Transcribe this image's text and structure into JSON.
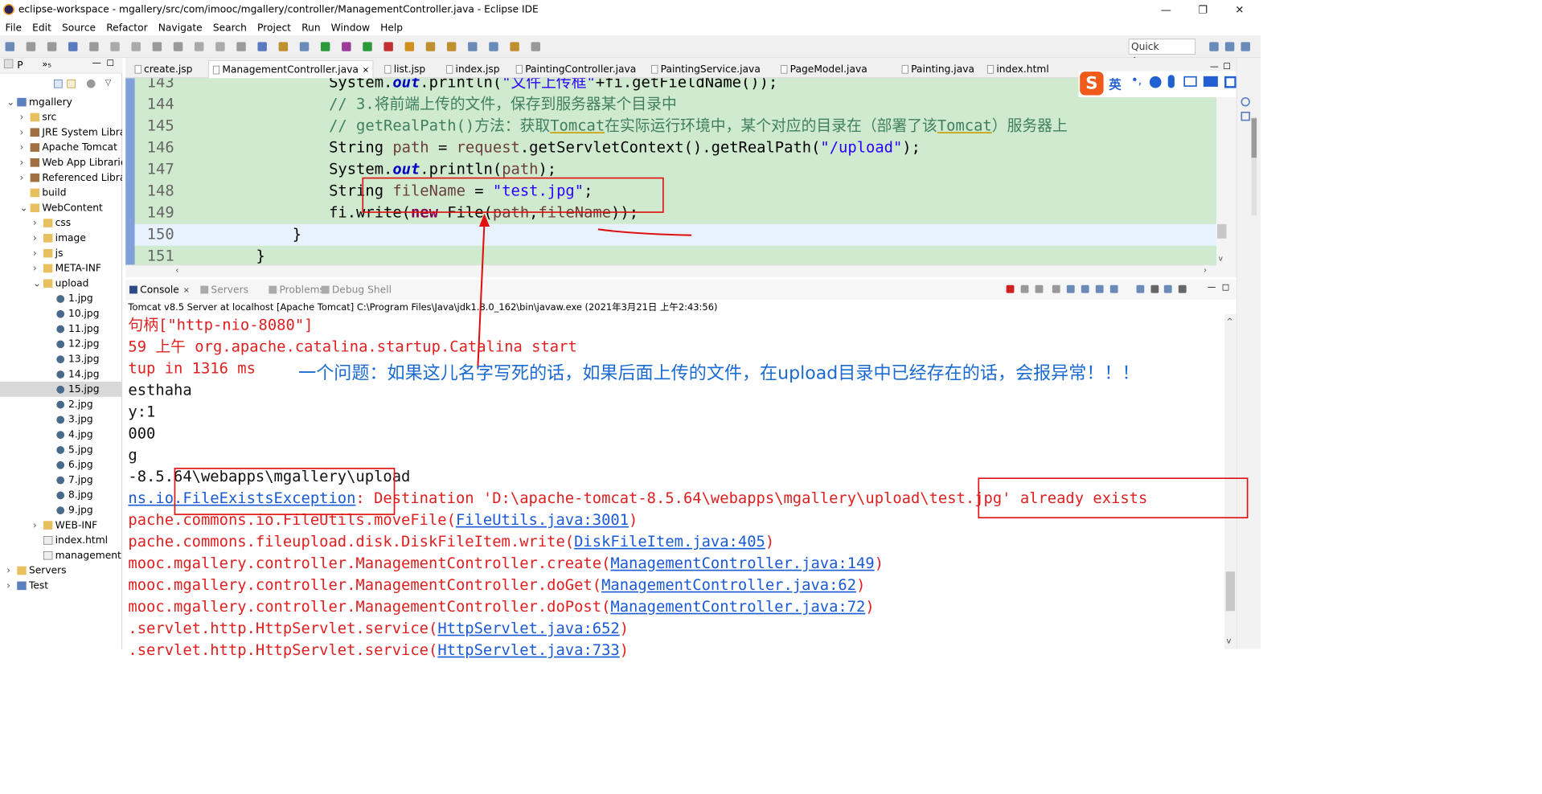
{
  "window": {
    "title": "eclipse-workspace - mgallery/src/com/imooc/mgallery/controller/ManagementController.java - Eclipse IDE",
    "minimize_label": "—",
    "restore_label": "❐",
    "close_label": "✕"
  },
  "menu": [
    "File",
    "Edit",
    "Source",
    "Refactor",
    "Navigate",
    "Search",
    "Project",
    "Run",
    "Window",
    "Help"
  ],
  "quick_access": {
    "placeholder": "Quick Access"
  },
  "explorer": {
    "tab_label": "P",
    "tab_label2": "»₅",
    "items": [
      {
        "label": "mgallery",
        "depth": 0,
        "twisty": "v",
        "icon": "project-icon"
      },
      {
        "label": "src",
        "depth": 1,
        "twisty": ">",
        "icon": "folder-icon"
      },
      {
        "label": "JRE System Library",
        "depth": 1,
        "twisty": ">",
        "icon": "library-icon"
      },
      {
        "label": "Apache Tomcat",
        "depth": 1,
        "twisty": ">",
        "icon": "library-icon"
      },
      {
        "label": "Web App Libraries",
        "depth": 1,
        "twisty": ">",
        "icon": "library-icon"
      },
      {
        "label": "Referenced Libraries",
        "depth": 1,
        "twisty": ">",
        "icon": "library-icon"
      },
      {
        "label": "build",
        "depth": 1,
        "twisty": "",
        "icon": "folder-icon"
      },
      {
        "label": "WebContent",
        "depth": 1,
        "twisty": "v",
        "icon": "folder-icon"
      },
      {
        "label": "css",
        "depth": 2,
        "twisty": ">",
        "icon": "folder-icon"
      },
      {
        "label": "image",
        "depth": 2,
        "twisty": ">",
        "icon": "folder-icon"
      },
      {
        "label": "js",
        "depth": 2,
        "twisty": ">",
        "icon": "folder-icon"
      },
      {
        "label": "META-INF",
        "depth": 2,
        "twisty": ">",
        "icon": "folder-icon"
      },
      {
        "label": "upload",
        "depth": 2,
        "twisty": "v",
        "icon": "folder-icon"
      },
      {
        "label": "1.jpg",
        "depth": 3,
        "twisty": "",
        "icon": "image-file-icon"
      },
      {
        "label": "10.jpg",
        "depth": 3,
        "twisty": "",
        "icon": "image-file-icon"
      },
      {
        "label": "11.jpg",
        "depth": 3,
        "twisty": "",
        "icon": "image-file-icon"
      },
      {
        "label": "12.jpg",
        "depth": 3,
        "twisty": "",
        "icon": "image-file-icon"
      },
      {
        "label": "13.jpg",
        "depth": 3,
        "twisty": "",
        "icon": "image-file-icon"
      },
      {
        "label": "14.jpg",
        "depth": 3,
        "twisty": "",
        "icon": "image-file-icon"
      },
      {
        "label": "15.jpg",
        "depth": 3,
        "twisty": "",
        "icon": "image-file-icon",
        "selected": true
      },
      {
        "label": "2.jpg",
        "depth": 3,
        "twisty": "",
        "icon": "image-file-icon"
      },
      {
        "label": "3.jpg",
        "depth": 3,
        "twisty": "",
        "icon": "image-file-icon"
      },
      {
        "label": "4.jpg",
        "depth": 3,
        "twisty": "",
        "icon": "image-file-icon"
      },
      {
        "label": "5.jpg",
        "depth": 3,
        "twisty": "",
        "icon": "image-file-icon"
      },
      {
        "label": "6.jpg",
        "depth": 3,
        "twisty": "",
        "icon": "image-file-icon"
      },
      {
        "label": "7.jpg",
        "depth": 3,
        "twisty": "",
        "icon": "image-file-icon"
      },
      {
        "label": "8.jpg",
        "depth": 3,
        "twisty": "",
        "icon": "image-file-icon"
      },
      {
        "label": "9.jpg",
        "depth": 3,
        "twisty": "",
        "icon": "image-file-icon"
      },
      {
        "label": "WEB-INF",
        "depth": 2,
        "twisty": ">",
        "icon": "folder-icon"
      },
      {
        "label": "index.html",
        "depth": 2,
        "twisty": "",
        "icon": "file-icon"
      },
      {
        "label": "management.",
        "depth": 2,
        "twisty": "",
        "icon": "file-icon"
      },
      {
        "label": "Servers",
        "depth": 0,
        "twisty": ">",
        "icon": "folder-icon"
      },
      {
        "label": "Test",
        "depth": 0,
        "twisty": ">",
        "icon": "project-icon"
      }
    ]
  },
  "editor": {
    "tabs": [
      {
        "label": "create.jsp",
        "active": false
      },
      {
        "label": "ManagementController.java",
        "active": true,
        "close": "✕"
      },
      {
        "label": "list.jsp",
        "active": false
      },
      {
        "label": "index.jsp",
        "active": false
      },
      {
        "label": "PaintingController.java",
        "active": false
      },
      {
        "label": "PaintingService.java",
        "active": false
      },
      {
        "label": "PageModel.java",
        "active": false
      },
      {
        "label": "Painting.java",
        "active": false
      },
      {
        "label": "index.html",
        "active": false
      }
    ],
    "lines": [
      {
        "num": "143",
        "indent": "                 ",
        "parts": [
          [
            "System.",
            ""
          ],
          [
            "out",
            "fld"
          ],
          [
            ".println(",
            ""
          ],
          [
            "\"文件上传框\"",
            "str"
          ],
          [
            "+fi.getFieldName());",
            ""
          ]
        ]
      },
      {
        "num": "144",
        "indent": "                 ",
        "parts": [
          [
            "// 3.将前端上传的文件，保存到服务器某个目录中",
            "cmt"
          ]
        ]
      },
      {
        "num": "145",
        "indent": "                 ",
        "parts": [
          [
            "// getRealPath()方法：获取",
            "cmt"
          ],
          [
            "Tomcat",
            "cmt und"
          ],
          [
            "在实际运行环境中，某个对应的目录在（部署了该",
            "cmt"
          ],
          [
            "Tomcat",
            "cmt und"
          ],
          [
            "）服务器上",
            "cmt"
          ]
        ]
      },
      {
        "num": "146",
        "indent": "                 ",
        "parts": [
          [
            "String ",
            ""
          ],
          [
            "path",
            "var"
          ],
          [
            " = ",
            ""
          ],
          [
            "request",
            "var"
          ],
          [
            ".getServletContext().getRealPath(",
            ""
          ],
          [
            "\"/upload\"",
            "str"
          ],
          [
            ");",
            ""
          ]
        ]
      },
      {
        "num": "147",
        "indent": "                 ",
        "parts": [
          [
            "System.",
            ""
          ],
          [
            "out",
            "fld"
          ],
          [
            ".println(",
            ""
          ],
          [
            "path",
            "var"
          ],
          [
            ");",
            ""
          ]
        ]
      },
      {
        "num": "148",
        "indent": "                 ",
        "parts": [
          [
            "String ",
            ""
          ],
          [
            "fileName",
            "var"
          ],
          [
            " = ",
            ""
          ],
          [
            "\"test.jpg\"",
            "str"
          ],
          [
            ";",
            ""
          ]
        ]
      },
      {
        "num": "149",
        "indent": "                 ",
        "parts": [
          [
            "fi.write(",
            ""
          ],
          [
            "new",
            "kw"
          ],
          [
            " File(",
            ""
          ],
          [
            "path",
            "var"
          ],
          [
            ",",
            ""
          ],
          [
            "fileName",
            "var"
          ],
          [
            "));",
            ""
          ]
        ]
      },
      {
        "num": "150",
        "indent": "             ",
        "parts": [
          [
            "}",
            ""
          ]
        ],
        "current": true
      },
      {
        "num": "151",
        "indent": "         ",
        "parts": [
          [
            "}",
            ""
          ]
        ]
      }
    ]
  },
  "console": {
    "tabs": [
      {
        "label": "Console",
        "active": true,
        "icon": "console-icon"
      },
      {
        "label": "Servers",
        "active": false,
        "icon": "servers-icon"
      },
      {
        "label": "Problems",
        "active": false,
        "icon": "problems-icon"
      },
      {
        "label": "Debug Shell",
        "active": false,
        "icon": "debug-shell-icon"
      }
    ],
    "header": "Tomcat v8.5 Server at localhost [Apache Tomcat] C:\\Program Files\\Java\\jdk1.8.0_162\\bin\\javaw.exe (2021年3月21日 上午2:43:56)",
    "lines": [
      {
        "parts": [
          [
            "句柄[\"http-nio-8080\"]",
            ""
          ]
        ],
        "color": "red"
      },
      {
        "parts": [
          [
            "59 上午 org.apache.catalina.startup.Catalina start",
            ""
          ]
        ],
        "color": "red"
      },
      {
        "parts": [
          [
            "tup in 1316 ms",
            ""
          ]
        ],
        "color": "red"
      },
      {
        "parts": [
          [
            "esthaha",
            ""
          ]
        ],
        "color": "black"
      },
      {
        "parts": [
          [
            "y:1",
            ""
          ]
        ],
        "color": "black"
      },
      {
        "parts": [
          [
            "000",
            ""
          ]
        ],
        "color": "black"
      },
      {
        "parts": [
          [
            "g",
            ""
          ]
        ],
        "color": "black"
      },
      {
        "parts": [
          [
            "-8.5.64\\webapps\\mgallery\\upload",
            ""
          ]
        ],
        "color": "black"
      },
      {
        "parts": [
          [
            "ns.io.FileExistsException",
            "lnk"
          ],
          [
            ": Destination 'D:\\apache-tomcat-8.5.64\\webapps\\mgallery\\upload\\test.jpg' already exists",
            ""
          ]
        ],
        "color": "red"
      },
      {
        "parts": [
          [
            "pache.commons.io.FileUtils.moveFile(",
            ""
          ],
          [
            "FileUtils.java:3001",
            "lnk"
          ],
          [
            ")",
            ""
          ]
        ],
        "color": "red"
      },
      {
        "parts": [
          [
            "pache.commons.fileupload.disk.DiskFileItem.write(",
            ""
          ],
          [
            "DiskFileItem.java:405",
            "lnk"
          ],
          [
            ")",
            ""
          ]
        ],
        "color": "red"
      },
      {
        "parts": [
          [
            "mooc.mgallery.controller.ManagementController.create(",
            ""
          ],
          [
            "ManagementController.java:149",
            "lnk"
          ],
          [
            ")",
            ""
          ]
        ],
        "color": "red"
      },
      {
        "parts": [
          [
            "mooc.mgallery.controller.ManagementController.doGet(",
            ""
          ],
          [
            "ManagementController.java:62",
            "lnk"
          ],
          [
            ")",
            ""
          ]
        ],
        "color": "red"
      },
      {
        "parts": [
          [
            "mooc.mgallery.controller.ManagementController.doPost(",
            ""
          ],
          [
            "ManagementController.java:72",
            "lnk"
          ],
          [
            ")",
            ""
          ]
        ],
        "color": "red"
      },
      {
        "parts": [
          [
            ".servlet.http.HttpServlet.service(",
            ""
          ],
          [
            "HttpServlet.java:652",
            "lnk"
          ],
          [
            ")",
            ""
          ]
        ],
        "color": "red"
      },
      {
        "parts": [
          [
            ".servlet.http.HttpServlet.service(",
            ""
          ],
          [
            "HttpServlet.java:733",
            "lnk"
          ],
          [
            ")",
            ""
          ]
        ],
        "color": "red"
      }
    ]
  },
  "annotation": {
    "note": "一个问题：如果这儿名字写死的话，如果后面上传的文件，在upload目录中已经存在的话，会报异常！！！",
    "note_color": "#1a6ad0",
    "box_color": "#e01010"
  },
  "ime": {
    "label": "英"
  },
  "colors": {
    "editor_bg": "#cfeacf",
    "current_line": "#e8f2fe",
    "keyword": "#7f0055",
    "string": "#2a00ff",
    "comment": "#3f7f5f",
    "console_error": "#e02020",
    "link": "#1a5ad6"
  }
}
